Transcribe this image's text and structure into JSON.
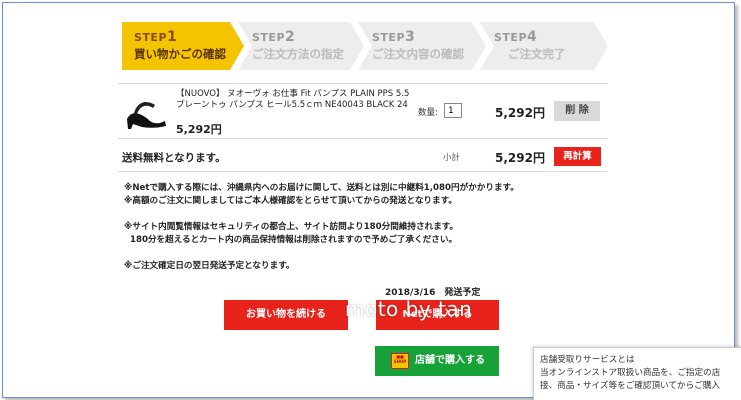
{
  "steps": [
    {
      "num": "STEP",
      "n": "1",
      "label": "買い物かごの確認"
    },
    {
      "num": "STEP",
      "n": "2",
      "label": "ご注文方法の指定"
    },
    {
      "num": "STEP",
      "n": "3",
      "label": "ご注文内容の確認"
    },
    {
      "num": "STEP",
      "n": "4",
      "label": "ご注文完了"
    }
  ],
  "item": {
    "name": "【NUOVO】 ヌオーヴォ お仕事 Fit パンプス PLAIN PPS 5.5 プレーントゥ パンプス ヒール5.5ｃｍ NE40043 BLACK 24",
    "unit_price": "5,292円",
    "qty_label": "数量:",
    "qty_value": "1",
    "price": "5,292円",
    "delete_label": "削 除"
  },
  "subtotal": {
    "free_shipping": "送料無料となります。",
    "label": "小計",
    "price": "5,292円",
    "recalc_label": "再計算"
  },
  "notes": [
    "※Netで購入する際には、沖縄県内へのお届けに関して、送料とは別に中継料1,080円がかかります。",
    "※高額のご注文に関しましてはご本人様確認をとらせて頂いてからの発送となります。",
    "※サイト内閲覧情報はセキュリティの都合上、サイト訪問より180分間維持されます。",
    "180分を超えるとカート内の商品保持情報は削除されますので予めご了承ください。",
    "※ご注文確定日の翌日発送予定となります。"
  ],
  "ship_date": "2018/3/16　発送予定",
  "buttons": {
    "continue": "お買い物を続ける",
    "checkout": "Netで購入する",
    "store": "店舗で購入する"
  },
  "watermark": "moto by tan",
  "panel": {
    "title": "店舗受取りサービスとは",
    "line1": "当オンラインストア取扱い商品を、ご指定の店",
    "line2": "接、商品・サイズ等をご確認頂いてからご購入"
  },
  "colors": {
    "step_active": "#f5c400",
    "red": "#e8231b",
    "green": "#16a238"
  }
}
